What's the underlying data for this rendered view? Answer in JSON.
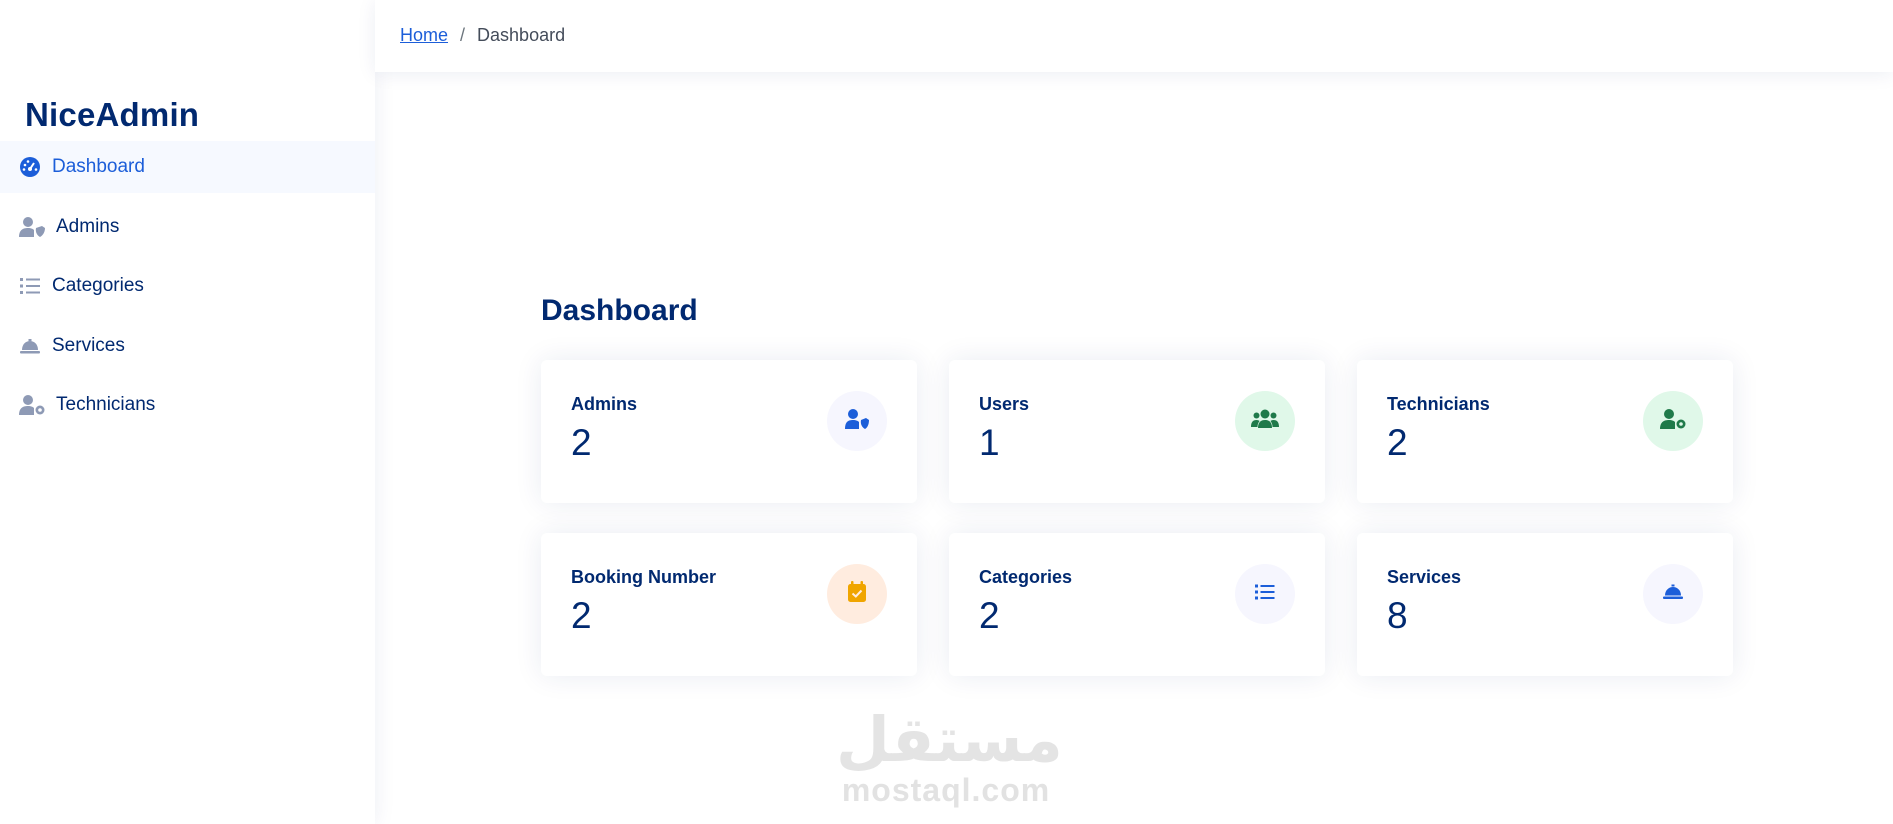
{
  "app": {
    "logo": "NiceAdmin"
  },
  "colors": {
    "primary": "#012970",
    "accent": "#1c5ed9",
    "green": "#2eca6a",
    "orange": "#ff771d"
  },
  "sidebar": {
    "items": [
      {
        "label": "Dashboard",
        "icon": "gauge-icon",
        "active": true
      },
      {
        "label": "Admins",
        "icon": "user-shield-icon"
      },
      {
        "label": "Categories",
        "icon": "list-icon"
      },
      {
        "label": "Services",
        "icon": "service-bell-icon"
      },
      {
        "label": "Technicians",
        "icon": "user-gear-icon"
      }
    ]
  },
  "breadcrumb": {
    "home": "Home",
    "separator": "/",
    "current": "Dashboard"
  },
  "main": {
    "title": "Dashboard",
    "cards": [
      {
        "label": "Admins",
        "value": "2",
        "icon": "user-shield-icon"
      },
      {
        "label": "Users",
        "value": "1",
        "icon": "users-icon"
      },
      {
        "label": "Technicians",
        "value": "2",
        "icon": "user-gear-icon"
      },
      {
        "label": "Booking Number",
        "value": "2",
        "icon": "calendar-check-icon"
      },
      {
        "label": "Categories",
        "value": "2",
        "icon": "list-icon"
      },
      {
        "label": "Services",
        "value": "8",
        "icon": "service-bell-icon"
      }
    ]
  },
  "watermark": {
    "arabic": "مستقل",
    "latin": "mostaql.com"
  }
}
